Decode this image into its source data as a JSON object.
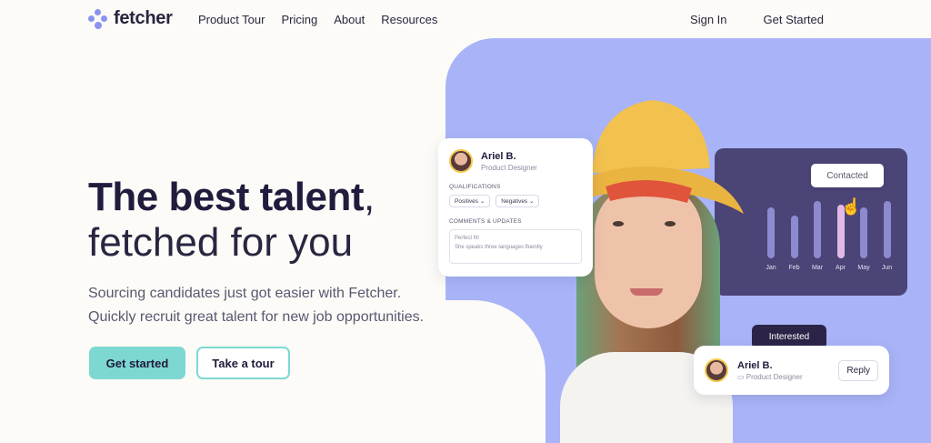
{
  "nav": {
    "logo": "fetcher",
    "links": [
      "Product Tour",
      "Pricing",
      "About",
      "Resources"
    ],
    "sign_in": "Sign In",
    "get_started": "Get Started"
  },
  "hero": {
    "headline_strong": "The best talent",
    "headline_comma": ",",
    "headline_light": "fetched for you",
    "sub_line1": "Sourcing candidates just got easier with Fetcher.",
    "sub_line2": "Quickly recruit great talent for new job opportunities.",
    "primary_cta": "Get started",
    "secondary_cta": "Take a tour"
  },
  "candidate_card": {
    "name": "Ariel B.",
    "role": "Product Designer",
    "qualifications_label": "QUALIFICATIONS",
    "positives": "Positives",
    "negatives": "Negatives",
    "comments_label": "COMMENTS & UPDATES",
    "comment_line1": "Perfect fit!",
    "comment_line2": "She speaks three languages fluently"
  },
  "chart": {
    "tooltip": "Contacted",
    "months": [
      "Jan",
      "Feb",
      "Mar",
      "Apr",
      "May",
      "Jun"
    ],
    "bar_fill": [
      0.62,
      0.52,
      0.7,
      0.66,
      0.62,
      0.7
    ],
    "highlight_index": 3,
    "colors": {
      "bar": "#8e8ad0",
      "highlight": "#e2b8e6",
      "bg": "#4b4477"
    }
  },
  "bottom_card": {
    "tooltip": "Interested",
    "name": "Ariel B.",
    "role": "Product Designer",
    "reply": "Reply"
  },
  "colors": {
    "accent": "#7ed8d2",
    "blob": "#a8b4f7",
    "ink": "#211b3d"
  }
}
